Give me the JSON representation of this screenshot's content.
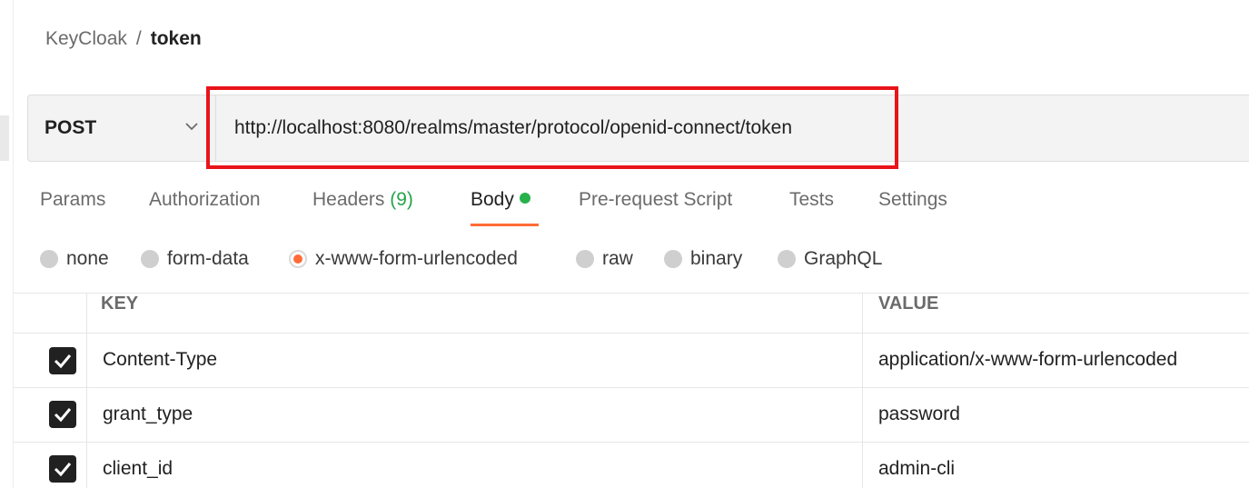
{
  "breadcrumb": {
    "parent": "KeyCloak",
    "separator": "/",
    "current": "token"
  },
  "request": {
    "method": "POST",
    "url": "http://localhost:8080/realms/master/protocol/openid-connect/token"
  },
  "tabs": {
    "params": "Params",
    "authorization": "Authorization",
    "headers": "Headers",
    "headers_count": "(9)",
    "body": "Body",
    "prerequest": "Pre-request Script",
    "tests": "Tests",
    "settings": "Settings",
    "active": "Body"
  },
  "body_modes": {
    "options": [
      "none",
      "form-data",
      "x-www-form-urlencoded",
      "raw",
      "binary",
      "GraphQL"
    ],
    "selected": "x-www-form-urlencoded"
  },
  "table": {
    "headers": {
      "key": "KEY",
      "value": "VALUE"
    },
    "rows": [
      {
        "checked": true,
        "key": "Content-Type",
        "value": "application/x-www-form-urlencoded"
      },
      {
        "checked": true,
        "key": "grant_type",
        "value": "password"
      },
      {
        "checked": true,
        "key": "client_id",
        "value": "admin-cli"
      }
    ]
  },
  "colors": {
    "accent": "#ff6c37",
    "highlight": "#e8141a",
    "indicator": "#26b24b"
  }
}
